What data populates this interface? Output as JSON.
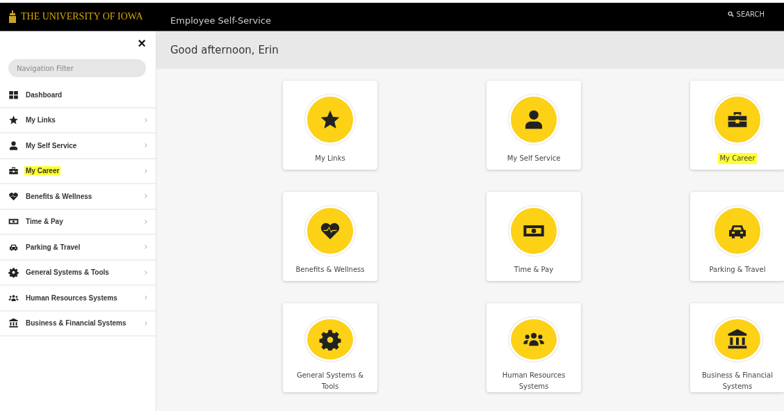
{
  "header": {
    "logo": "THE UNIVERSITY OF IOWA",
    "app_title": "Employee Self-Service",
    "search": "SEARCH"
  },
  "sidebar": {
    "close": "×",
    "filter_placeholder": "Navigation Filter",
    "items": [
      {
        "label": "Dashboard",
        "has_arrow": false,
        "highlighted": false
      },
      {
        "label": "My Links",
        "has_arrow": true,
        "highlighted": false
      },
      {
        "label": "My Self Service",
        "has_arrow": true,
        "highlighted": false
      },
      {
        "label": "My Career",
        "has_arrow": true,
        "highlighted": true
      },
      {
        "label": "Benefits & Wellness",
        "has_arrow": true,
        "highlighted": false
      },
      {
        "label": "Time & Pay",
        "has_arrow": true,
        "highlighted": false
      },
      {
        "label": "Parking & Travel",
        "has_arrow": true,
        "highlighted": false
      },
      {
        "label": "General Systems & Tools",
        "has_arrow": true,
        "highlighted": false
      },
      {
        "label": "Human Resources Systems",
        "has_arrow": true,
        "highlighted": false
      },
      {
        "label": "Business & Financial Systems",
        "has_arrow": true,
        "highlighted": false
      }
    ]
  },
  "greeting": "Good afternoon, Erin",
  "tiles": [
    {
      "label": "My Links",
      "highlighted": false
    },
    {
      "label": "My Self Service",
      "highlighted": false
    },
    {
      "label": "My Career",
      "highlighted": true
    },
    {
      "label": "Benefits & Wellness",
      "highlighted": false
    },
    {
      "label": "Time & Pay",
      "highlighted": false
    },
    {
      "label": "Parking & Travel",
      "highlighted": false
    },
    {
      "label": "General Systems & Tools",
      "highlighted": false
    },
    {
      "label": "Human Resources Systems",
      "highlighted": false
    },
    {
      "label": "Business & Financial Systems",
      "highlighted": false
    }
  ]
}
